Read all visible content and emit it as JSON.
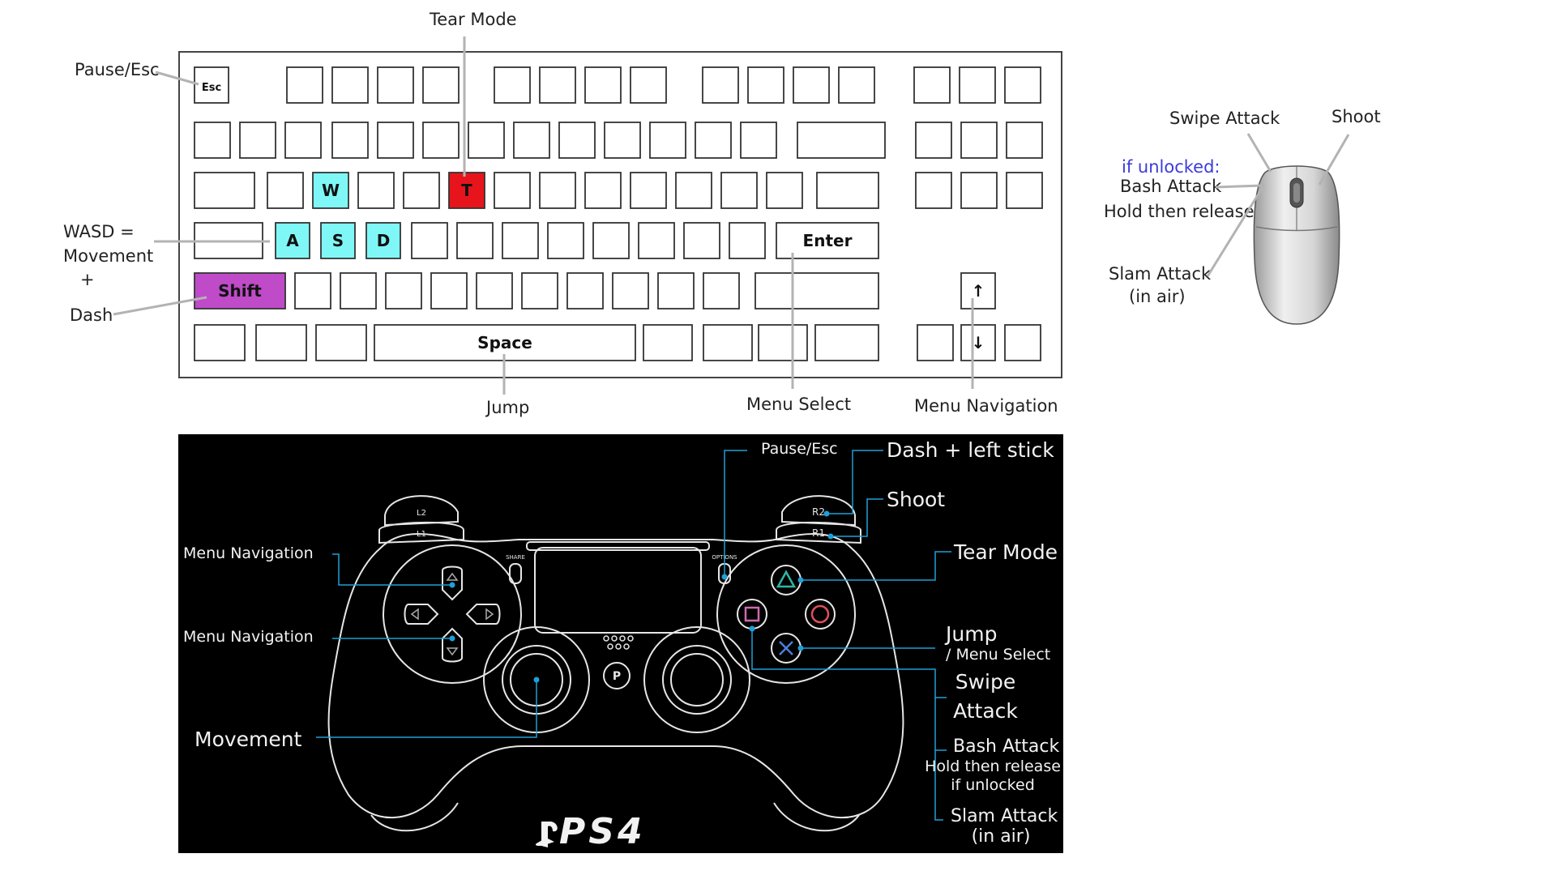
{
  "colors": {
    "tear_key": "#e8141c",
    "wasd_key": "#7ff7f7",
    "shift_key": "#bf4bc9",
    "unlock_text": "#3b3bdb",
    "leader_gray": "#b3b3b3",
    "pad_accent": "#1f9fd8"
  },
  "keyboard": {
    "keys": {
      "esc": "Esc",
      "t": "T",
      "w": "W",
      "a": "A",
      "s": "S",
      "d": "D",
      "enter": "Enter",
      "shift": "Shift",
      "space": "Space",
      "arrow_up": "↑",
      "arrow_down": "↓"
    },
    "labels": {
      "tear_mode": "Tear Mode",
      "pause_esc": "Pause/Esc",
      "wasd_eq": "WASD =",
      "movement": "Movement",
      "plus": "+",
      "dash": "Dash",
      "jump": "Jump",
      "menu_select": "Menu Select",
      "menu_navigation": "Menu Navigation"
    }
  },
  "mouse": {
    "labels": {
      "swipe_attack": "Swipe Attack",
      "shoot": "Shoot",
      "if_unlocked": "if unlocked:",
      "bash_attack": "Bash Attack",
      "hold_then_release": "Hold then release",
      "slam_attack": "Slam Attack",
      "in_air": "(in air)"
    }
  },
  "controller": {
    "brand": "PS4",
    "labels": {
      "pause_esc": "Pause/Esc",
      "dash_left_stick": "Dash + left stick",
      "shoot": "Shoot",
      "tear_mode": "Tear Mode",
      "menu_navigation_1": "Menu Navigation",
      "menu_navigation_2": "Menu Navigation",
      "jump": "Jump",
      "menu_select": "/ Menu Select",
      "swipe": "Swipe",
      "attack": "Attack",
      "bash_attack": "Bash Attack",
      "hold_then_release": "Hold then release",
      "if_unlocked": "if unlocked",
      "slam_attack": "Slam Attack",
      "in_air": "(in air)",
      "movement": "Movement"
    },
    "button_text": {
      "l2": "L2",
      "l1": "L1",
      "r2": "R2",
      "r1": "R1",
      "share": "SHARE",
      "options": "OPTIONS"
    }
  }
}
